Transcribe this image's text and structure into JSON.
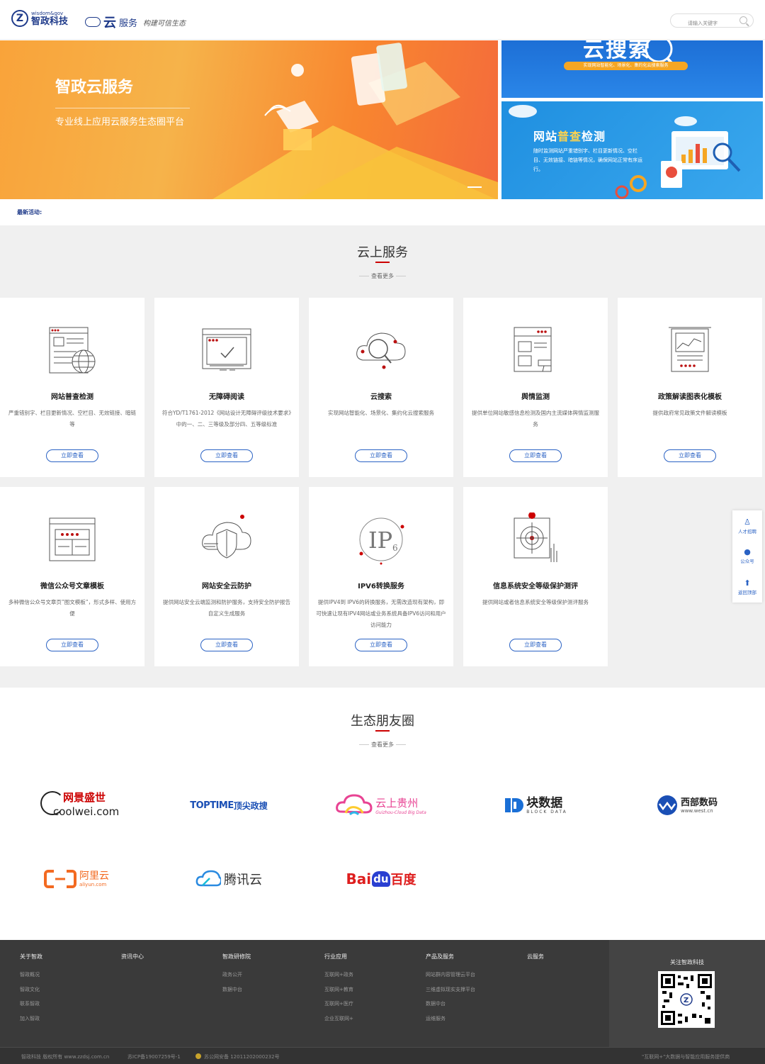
{
  "header": {
    "logo_mark": "Z",
    "logo_en": "wisdom&gov",
    "logo_cn": "智政科技",
    "cloud_char": "云",
    "cloud_word": "服务",
    "slogan": "构建可信生态",
    "search_placeholder": "请输入关键字"
  },
  "banner": {
    "title": "智政云服务",
    "subtitle": "专业线上应用云服务生态圈平台",
    "side1_title": "云搜索",
    "side1_pill": "实现网站智能化、场景化、集约化云搜索服务",
    "side2_title_a": "网站",
    "side2_title_b": "普查",
    "side2_title_c": "检测",
    "side2_desc": "随时监测网站严重错别字、栏目更新情况、空栏目、无效链接、暗链等情况，确保网站正常有序运行。"
  },
  "news": {
    "label": "最新活动:"
  },
  "services": {
    "title": "云上服务",
    "more": "查看更多",
    "button_label": "立即查看",
    "cards": [
      {
        "title": "网站普查检测",
        "desc": "严重错别字、栏目更新情况、空栏目、无效链接、暗链等",
        "icon": "website-check-icon"
      },
      {
        "title": "无障碍阅读",
        "desc": "符合YD/T1761-2012《网站设计无障碍评级技术要求》中的一、二、三等级及部分四、五等级标准",
        "icon": "accessibility-icon"
      },
      {
        "title": "云搜索",
        "desc": "实现网站智能化、场景化、集约化云搜索服务",
        "icon": "cloud-search-icon"
      },
      {
        "title": "舆情监测",
        "desc": "提供单位网站敏感信息检测及国内主流媒体舆情监测服务",
        "icon": "monitoring-icon"
      },
      {
        "title": "政策解读图表化模板",
        "desc": "提供政府常见政策文件解读模板",
        "icon": "chart-template-icon"
      },
      {
        "title": "微信公众号文章模板",
        "desc": "多种微信公众号文章页”图文模板”，形式多样、使用方便",
        "icon": "wechat-template-icon"
      },
      {
        "title": "网站安全云防护",
        "desc": "提供网站安全云端监测和防护服务，支持安全防护报告自定义生成服务",
        "icon": "cloud-shield-icon"
      },
      {
        "title": "IPV6转换服务",
        "desc": "提供IPV4到 IPV6的转换服务，无需改造现有架构，即可快速让现有IPV4网站或业务系统具备IPV6访问和用户访问能力",
        "icon": "ipv6-icon"
      },
      {
        "title": "信息系统安全等级保护测评",
        "desc": "提供网站或者信息系统安全等级保护测评服务",
        "icon": "target-icon"
      }
    ]
  },
  "float_bar": {
    "items": [
      {
        "label": "人才招聘",
        "icon": "person-icon"
      },
      {
        "label": "公众号",
        "icon": "wechat-icon"
      },
      {
        "label": "返回顶部",
        "icon": "arrow-up-icon"
      }
    ]
  },
  "partners": {
    "title": "生态朋友圈",
    "more": "查看更多",
    "logos": {
      "coolwei_cn": "网景盛世",
      "coolwei_en": "coolwei.com",
      "toptime_en": "TOPTIME",
      "toptime_cn": "顶尖政搜",
      "guizhou_cn": "云上贵州",
      "guizhou_en": "Guizhou-Cloud Big Data",
      "block_cn": "块数据",
      "block_en": "BLOCK DATA",
      "west_cn": "西部数码",
      "west_en": "www.west.cn",
      "aliyun_cn": "阿里云",
      "aliyun_en": "aliyun.com",
      "tencent_cn": "腾讯云",
      "baidu_a": "Bai",
      "baidu_b": "du",
      "baidu_c": "百度"
    }
  },
  "footer": {
    "columns": [
      {
        "heading": "关于智政",
        "links": [
          "智政概况",
          "智政文化",
          "联系智政",
          "加入智政"
        ]
      },
      {
        "heading": "资讯中心",
        "links": []
      },
      {
        "heading": "智政研修院",
        "links": [
          "政务公开",
          "数据中台"
        ]
      },
      {
        "heading": "行业应用",
        "links": [
          "互联网+政务",
          "互联网+教育",
          "互联网+医疗",
          "企业互联网+"
        ]
      },
      {
        "heading": "产品及服务",
        "links": [
          "网站群内容管理云平台",
          "三维虚拟现实支撑平台",
          "数据中台",
          "运维服务"
        ]
      },
      {
        "heading": "云服务",
        "links": []
      }
    ],
    "qr_title": "关注智政科技",
    "copyright": "智政科技 版权所有 www.zzdsj.com.cn",
    "icp": "苏ICP备19007259号-1",
    "police": "苏公网安备 12011202000232号",
    "tagline": "\"互联网+\"大数据与智能应用服务提供商"
  }
}
